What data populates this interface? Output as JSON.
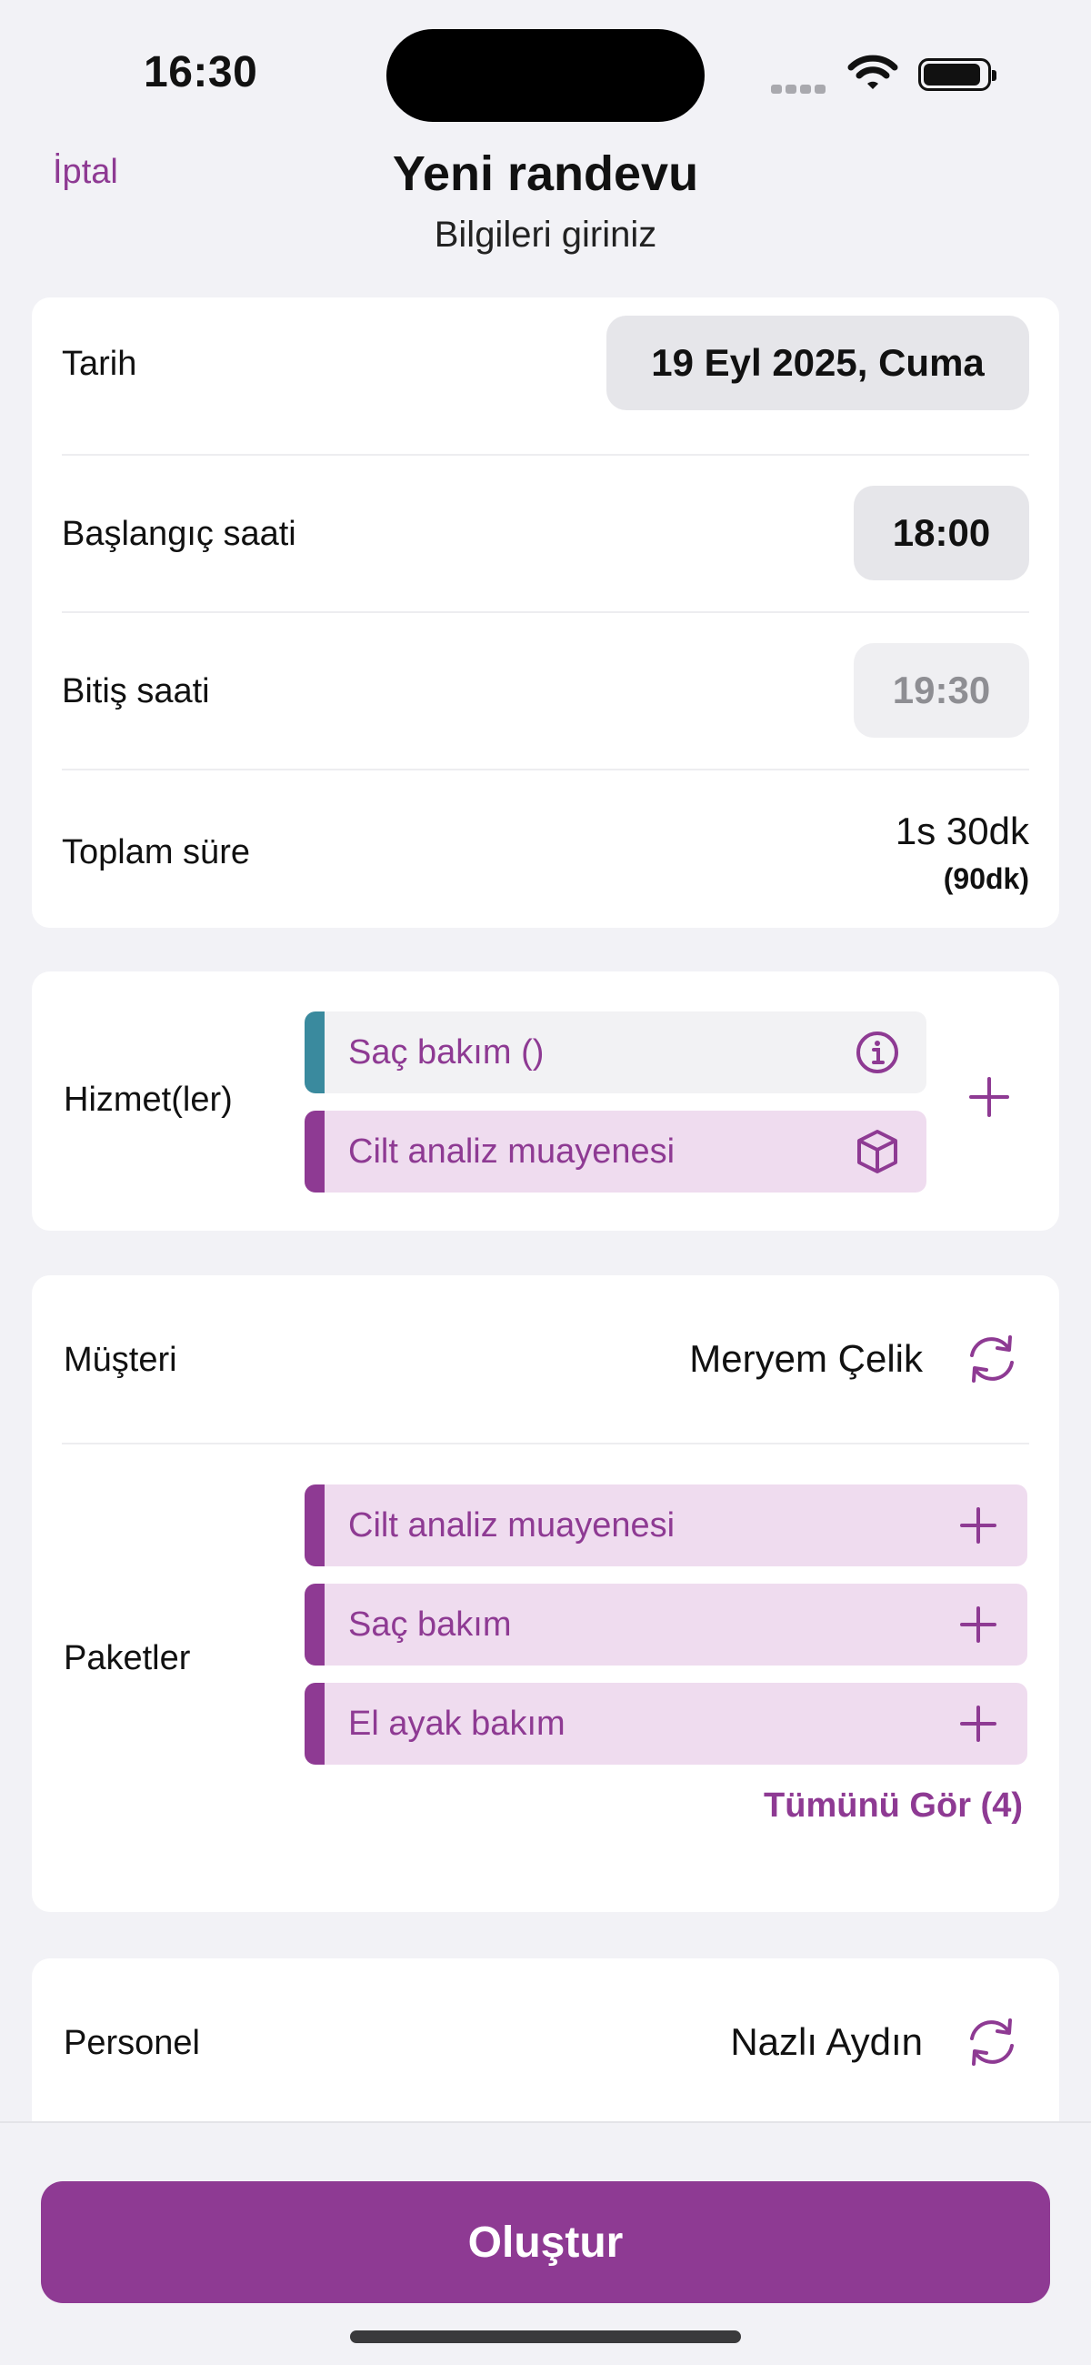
{
  "status_bar": {
    "time": "16:30"
  },
  "header": {
    "cancel_label": "İptal",
    "title": "Yeni randevu",
    "subtitle": "Bilgileri giriniz"
  },
  "datetime_card": {
    "date_label": "Tarih",
    "date_value": "19 Eyl 2025, Cuma",
    "start_label": "Başlangıç saati",
    "start_value": "18:00",
    "end_label": "Bitiş saati",
    "end_value": "19:30",
    "duration_label": "Toplam süre",
    "duration_value": "1s 30dk",
    "duration_minutes": "(90dk)"
  },
  "services_card": {
    "label": "Hizmet(ler)",
    "items": [
      {
        "name": "Saç bakım ()",
        "icon": "info-icon",
        "accent": "#3a8a9e"
      },
      {
        "name": "Cilt analiz muayenesi",
        "icon": "package-icon",
        "accent": "#8e3a93"
      }
    ]
  },
  "customer_card": {
    "customer_label": "Müşteri",
    "customer_value": "Meryem Çelik",
    "packages_label": "Paketler",
    "packages": [
      {
        "name": "Cilt analiz muayenesi"
      },
      {
        "name": "Saç bakım"
      },
      {
        "name": "El ayak bakım"
      }
    ],
    "see_all_label": "Tümünü Gör (4)"
  },
  "staff_card": {
    "label": "Personel",
    "value": "Nazlı Aydın"
  },
  "footer": {
    "create_label": "Oluştur"
  },
  "colors": {
    "accent": "#8e3a93",
    "teal": "#3a8a9e",
    "background": "#f2f2f6"
  }
}
